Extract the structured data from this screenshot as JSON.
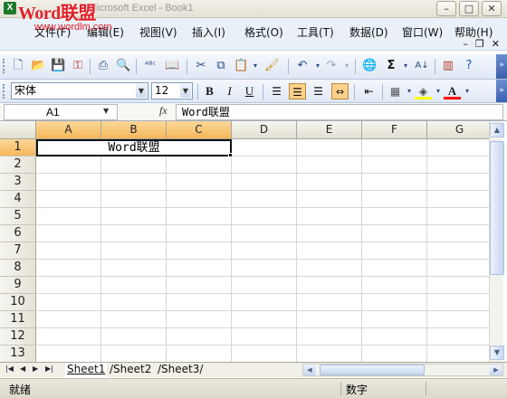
{
  "window": {
    "title": "Microsoft Excel - Book1",
    "minimize": "–",
    "maximize": "□",
    "close": "✕"
  },
  "watermark": {
    "brand": "Word联盟",
    "url": "www.wordlm.com"
  },
  "menu": {
    "items": [
      "文件(F)",
      "编辑(E)",
      "视图(V)",
      "插入(I)",
      "格式(O)",
      "工具(T)",
      "数据(D)",
      "窗口(W)",
      "帮助(H)"
    ],
    "doc_controls": [
      "–",
      "❐",
      "✕"
    ]
  },
  "toolbar": {
    "standard_icons": [
      "new-icon",
      "open-icon",
      "save-icon",
      "permission-icon",
      "print-icon",
      "print-preview-icon",
      "spelling-icon",
      "research-icon",
      "cut-icon",
      "copy-icon",
      "paste-icon",
      "format-painter-icon",
      "undo-icon",
      "redo-icon",
      "hyperlink-icon",
      "autosum-icon",
      "sort-ascending-icon",
      "chart-wizard-icon",
      "help-icon"
    ]
  },
  "formatting": {
    "font_name": "宋体",
    "font_size": "12",
    "bold": "B",
    "italic": "I",
    "underline": "U",
    "fill_color": "#ffff00",
    "font_color": "#ff0000"
  },
  "formula_bar": {
    "name_box": "A1",
    "fx": "fx",
    "content": "Word联盟"
  },
  "grid": {
    "columns": [
      "A",
      "B",
      "C",
      "D",
      "E",
      "F",
      "G"
    ],
    "rows": [
      "1",
      "2",
      "3",
      "4",
      "5",
      "6",
      "7",
      "8",
      "9",
      "10",
      "11",
      "12",
      "13"
    ],
    "merged_cell_text": "Word联盟"
  },
  "sheets": {
    "tabs": [
      "Sheet1",
      "Sheet2",
      "Sheet3"
    ],
    "active": "Sheet1"
  },
  "status": {
    "left": "就绪",
    "mode": "数字"
  },
  "colors": {
    "selection_header": "#f5b75a",
    "watermark": "#e0202a",
    "toolbar_accent": "#3a5fae"
  }
}
